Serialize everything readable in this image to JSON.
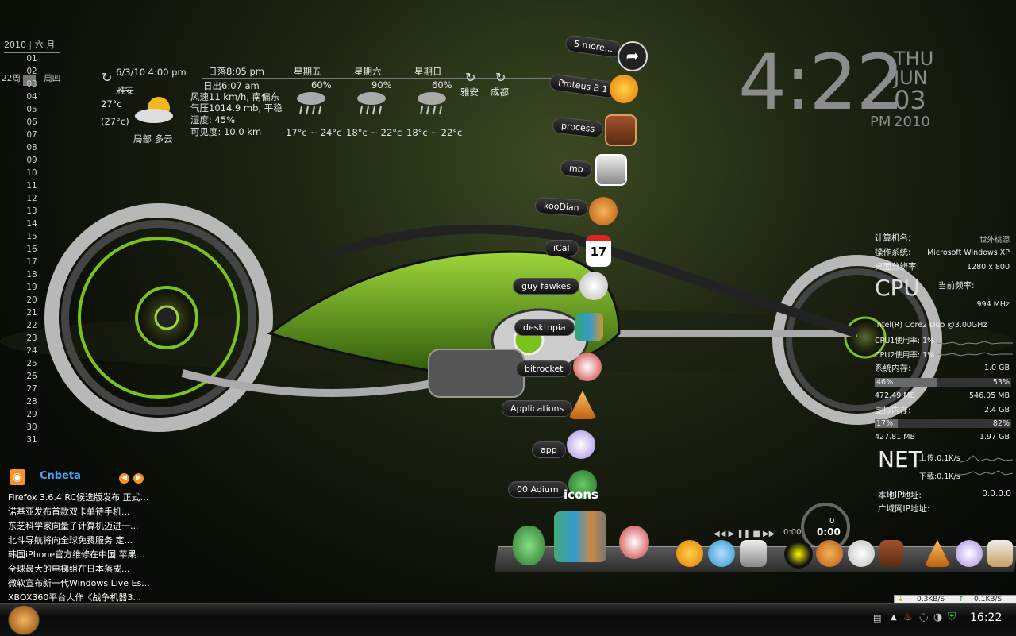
{
  "calendar": {
    "year": "2010",
    "month": "六 月",
    "selected_week": "22周",
    "selected_weekday": "周四",
    "days": [
      "01",
      "02",
      "03",
      "04",
      "05",
      "06",
      "07",
      "08",
      "09",
      "10",
      "11",
      "12",
      "13",
      "14",
      "15",
      "16",
      "17",
      "18",
      "19",
      "20",
      "21",
      "22",
      "23",
      "24",
      "25",
      "26",
      "27",
      "28",
      "29",
      "30",
      "31"
    ]
  },
  "weather": {
    "datetime": "6/3/10 4:00 pm",
    "city": "雅安",
    "temp": "27°c",
    "feels": "(27°c)",
    "condition": "局部 多云",
    "sunset": "日落8:05 pm",
    "sunrise": "日出6:07 am",
    "wind": "风速11 km/h, 南偏东",
    "pressure": "气压1014.9 mb, 平稳",
    "humidity": "湿度: 45%",
    "visibility": "可见度: 10.0 km",
    "forecast": [
      {
        "day": "星期五",
        "pct": "60%",
        "range": "17°c ~ 24°c"
      },
      {
        "day": "星期六",
        "pct": "90%",
        "range": "18°c ~ 22°c"
      },
      {
        "day": "星期日",
        "pct": "60%",
        "range": "18°c ~ 22°c"
      }
    ],
    "loc_a": "雅安",
    "loc_b": "成都"
  },
  "clock": {
    "time": "4:22",
    "weekday": "THU",
    "month": "JUN",
    "day": "03",
    "ampm": "PM",
    "year": "2010"
  },
  "dock_stack": {
    "items": [
      "5 more...",
      "Proteus B 1",
      "process",
      "mb",
      "kooDian",
      "iCal",
      "guy fawkes",
      "desktopia",
      "bitrocket",
      "Applications",
      "app",
      "00 Adium"
    ],
    "ical_day": "17",
    "icons_text": "icons"
  },
  "player": {
    "time_left": "0:00",
    "time_right": "0:00",
    "counter": "0"
  },
  "sysinfo": {
    "computer_label": "计算机名:",
    "computer_value": "世外桃源",
    "os_label": "操作系统:",
    "os_value": "Microsoft Windows XP",
    "res_label": "桌面分辨率:",
    "res_value": "1280 x 800",
    "cpu_title": "CPU",
    "freq_label": "当前频率:",
    "freq_value": "994 MHz",
    "cpu_model": "Intel(R) Core2 Duo @3.00GHz",
    "cpu1": "CPU1使用率:  1%",
    "cpu2": "CPU2使用率:  1%",
    "mem_label": "系统内存:",
    "mem_total": "1.0 GB",
    "mem_pct_a": "46%",
    "mem_pct_b": "53%",
    "mem_fill": 0.46,
    "mem_used": "472.49 MB",
    "mem_free": "546.05 MB",
    "vmem_label": "虚拟内存:",
    "vmem_total": "2.4 GB",
    "vmem_pct_a": "17%",
    "vmem_pct_b": "82%",
    "vmem_fill": 0.17,
    "vmem_used": "427.81 MB",
    "vmem_free": "1.97 GB",
    "net_title": "NET",
    "up": "上传:0.1K/s",
    "down": "下载:0.1K/s",
    "local_ip_label": "本地IP地址:",
    "local_ip": "0.0.0.0",
    "wan_ip_label": "广域网IP地址:"
  },
  "news": {
    "title": "Cnbeta",
    "items": [
      "Firefox 3.6.4 RC候选版发布 正式...",
      "诺基亚发布首款双卡单待手机...",
      "东芝科学家向量子计算机迈进一...",
      "北斗导航将向全球免费服务 定...",
      "韩国iPhone官方维修在中国 苹果...",
      "全球最大的电梯组在日本落成...",
      "微软宣布新一代Windows Live Es...",
      "XBOX360平台大作《战争机器3..."
    ]
  },
  "netmeter": {
    "down": "0.3KB/S",
    "up": "0.1KB/S"
  },
  "taskbar": {
    "clock": "16:22"
  },
  "colors": {
    "accent_green": "#7cc21c",
    "news_blue": "#4aa3ff"
  }
}
